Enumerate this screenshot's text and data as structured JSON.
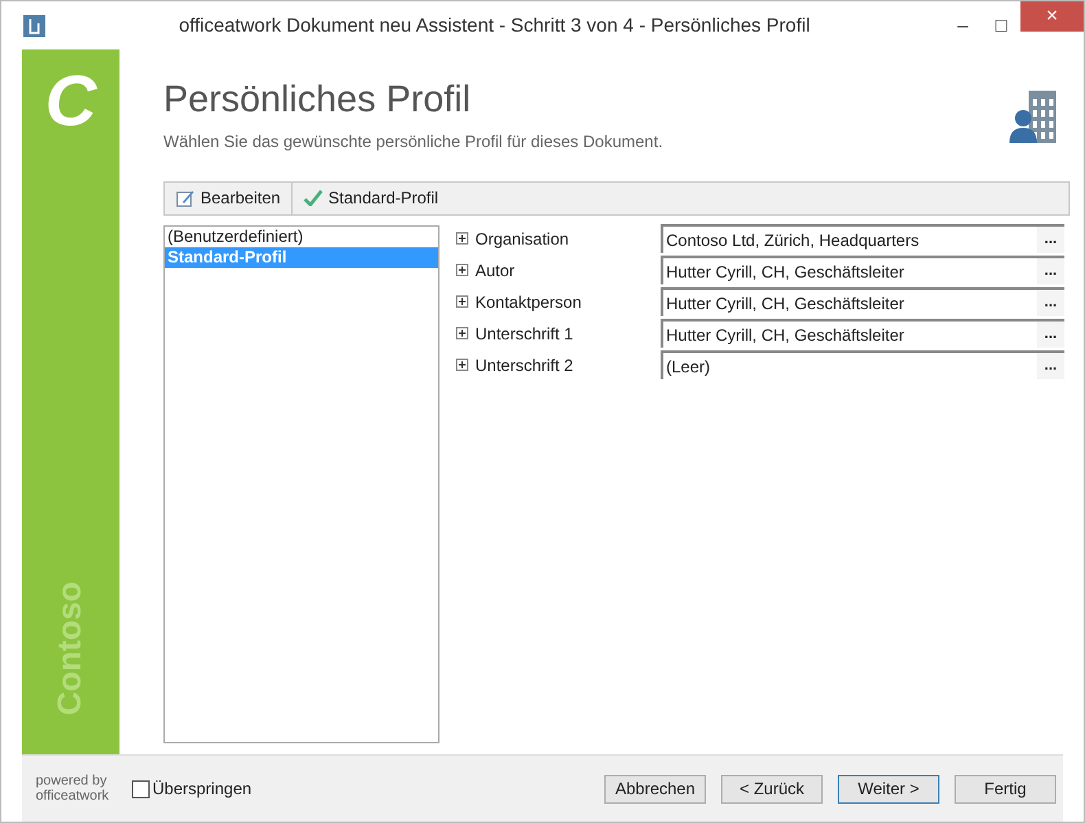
{
  "window": {
    "title": "officeatwork Dokument neu Assistent - Schritt 3 von 4 - Persönliches Profil",
    "controls": [
      "–",
      "□",
      "×"
    ]
  },
  "sidebar": {
    "logo": "C",
    "brand": "Contoso"
  },
  "header": {
    "title": "Persönliches Profil",
    "subtitle": "Wählen Sie das gewünschte persönliche Profil für dieses Dokument."
  },
  "toolbar": [
    {
      "label": "Bearbeiten",
      "kind": "edit"
    },
    {
      "label": "Standard-Profil",
      "kind": "check"
    }
  ],
  "profiles": [
    {
      "label": "(Benutzerdefiniert)",
      "selected": false
    },
    {
      "label": "Standard-Profil",
      "selected": true
    }
  ],
  "properties": [
    {
      "label": "Organisation",
      "value": "Contoso Ltd, Zürich, Headquarters",
      "button": "..."
    },
    {
      "label": "Autor",
      "value": "Hutter Cyrill, CH, Geschäftsleiter",
      "button": "..."
    },
    {
      "label": "Kontaktperson",
      "value": "Hutter Cyrill, CH, Geschäftsleiter",
      "button": "..."
    },
    {
      "label": "Unterschrift 1",
      "value": "Hutter Cyrill, CH, Geschäftsleiter",
      "button": "..."
    },
    {
      "label": "Unterschrift 2",
      "value": "(Leer)",
      "button": "..."
    }
  ],
  "footer": {
    "powered_by": "powered by",
    "vendor": "officeatwork",
    "skip": {
      "label": "Überspringen",
      "checked": false
    },
    "buttons": [
      {
        "label": "Abbrechen",
        "default": false
      },
      {
        "label": "< Zurück",
        "default": false
      },
      {
        "label": "Weiter >",
        "default": true
      },
      {
        "label": "Fertig",
        "default": false
      }
    ]
  }
}
